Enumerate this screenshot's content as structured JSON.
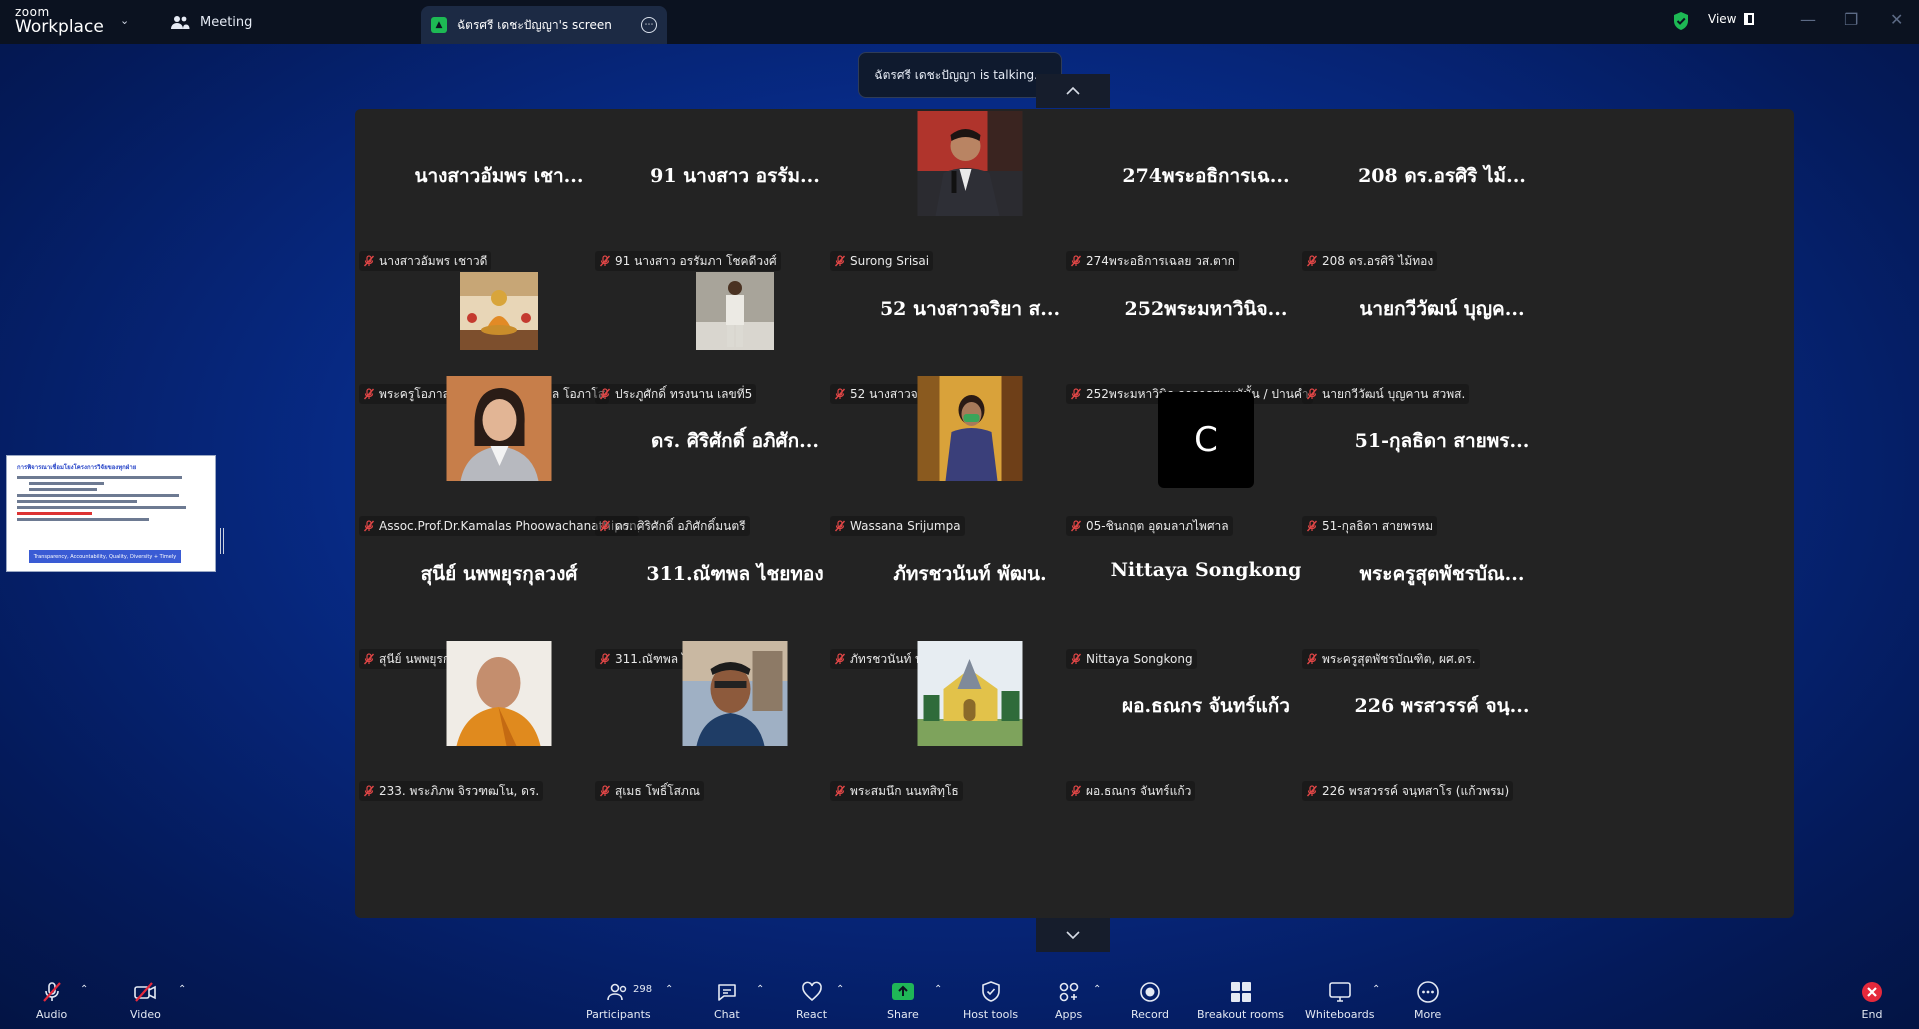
{
  "topbar": {
    "brand_small": "zoom",
    "brand_main": "Workplace",
    "meeting_label": "Meeting",
    "screen_tab_label": "ฉัตรศรี เดชะปัญญา's screen",
    "view_label": "View"
  },
  "talking_indicator": "ฉัตรศรี เดชะปัญญา is talking...",
  "thumbnail": {
    "title": "การพิจารณาเชื่อมโยงโครงการวิจัยของทุกฝ่าย",
    "footer": "Transparency, Accountability, Quality, Diversity + Timely"
  },
  "tiles": [
    {
      "big": "นางสาวอัมพร  เชา...",
      "name": "นางสาวอัมพร  เชาวดี",
      "photo": null
    },
    {
      "big": "91 นางสาว อรรัม...",
      "name": "91 นางสาว อรรัมภา โชคดีวงศ์",
      "photo": null
    },
    {
      "big": "",
      "name": "Surong Srisai",
      "photo": "man-microphone"
    },
    {
      "big": "274พระอธิการเฉ...",
      "name": "274พระอธิการเฉลย วส.ตาก",
      "photo": null
    },
    {
      "big": "208 ดร.อรศิริ  ไม้...",
      "name": "208 ดร.อรศิริ ไม้ทอง",
      "photo": null
    },
    {
      "big": "",
      "name": "พระครูโอภาสปัญญาวรคุณ ตันติกุล โอภาโส",
      "photo": "buddha-statue"
    },
    {
      "big": "",
      "name": "ประภูศักดิ์ ทรงนาน เลขที่5",
      "photo": "standing-person"
    },
    {
      "big": "52 นางสาวจริยา ส...",
      "name": "52 นางสาวจริยา สงวนัมย์",
      "photo": null
    },
    {
      "big": "252พระมหาวินิจ...",
      "name": "252พระมหาวินิจ อาจารสมบนันั้น / ปานคำ",
      "photo": null
    },
    {
      "big": "นายกวีวัฒน์ บุญค...",
      "name": "นายกวีวัฒน์ บุญคาน สวพส.",
      "photo": null
    },
    {
      "big": "",
      "name": "Assoc.Prof.Dr.Kamalas Phoowachanathipong",
      "photo": "woman-portrait"
    },
    {
      "big": "ดร. ศิริศักดิ์ อภิศัก...",
      "name": "ดร. ศิริศักดิ์ อภิศักดิ์มนตรี",
      "photo": null
    },
    {
      "big": "",
      "name": "Wassana Srijumpa",
      "photo": "woman-mask"
    },
    {
      "big": "",
      "name": "05-ชินกฤต อุดมลาภไพศาล",
      "photo": "letter-c"
    },
    {
      "big": "51-กุลธิดา สายพร...",
      "name": "51-กุลธิดา สายพรหม",
      "photo": null
    },
    {
      "big": "สุนีย์ นพพยุรกุลวงศ์",
      "name": "สุนีย์ นพพยุรกุลวงศ์",
      "photo": null
    },
    {
      "big": "311.ณัฑพล ไชยทอง",
      "name": "311.ณัฑพล ไชยทอง",
      "photo": null
    },
    {
      "big": "ภัทรชวนันท์ พัฒน.",
      "name": "ภัทรชวนันท์ พัฒน.",
      "photo": null
    },
    {
      "big": "Nittaya Songkong",
      "name": "Nittaya Songkong",
      "photo": null
    },
    {
      "big": "พระครูสุตพัชรบัณ...",
      "name": "พระครูสุตพัชรบัณฑิต, ผศ.ดร.",
      "photo": null
    },
    {
      "big": "",
      "name": "233. พระภิภพ จิรวฑฒโน, ดร.",
      "photo": "monk-portrait"
    },
    {
      "big": "",
      "name": "สุเมธ โพธิ์โสภณ",
      "photo": "man-selfie"
    },
    {
      "big": "",
      "name": "พระสมนึก นนทสิทฺโธ",
      "photo": "church-building"
    },
    {
      "big": "ผอ.ธณกร จันทร์แก้ว",
      "name": "ผอ.ธณกร จันทร์แก้ว",
      "photo": null
    },
    {
      "big": "226 พรสวรรค์ จนฺ...",
      "name": "226 พรสวรรค์ จนฺทสาโร (แก้วพรม)",
      "photo": null
    }
  ],
  "toolbar": {
    "audio": "Audio",
    "video": "Video",
    "participants": "Participants",
    "participants_count": "298",
    "chat": "Chat",
    "react": "React",
    "share": "Share",
    "host_tools": "Host tools",
    "apps": "Apps",
    "record": "Record",
    "breakout_rooms": "Breakout rooms",
    "whiteboards": "Whiteboards",
    "more": "More",
    "end": "End"
  },
  "colors": {
    "accent_green": "#1db954",
    "end_red": "#e5293c",
    "share_green": "#1fb657",
    "muted_red": "#e04646"
  }
}
